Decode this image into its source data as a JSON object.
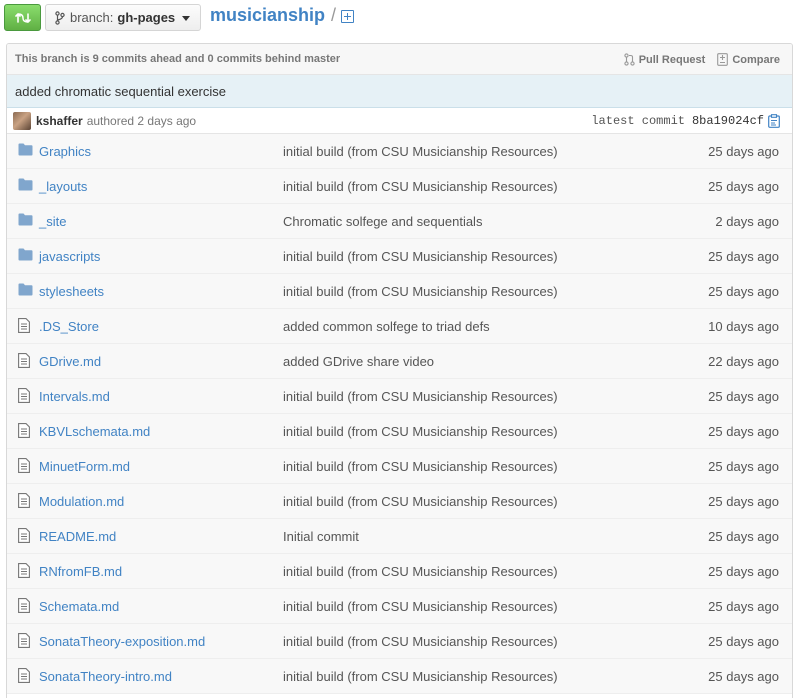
{
  "header": {
    "branch_prefix": "branch:",
    "branch_name": "gh-pages",
    "repo_name": "musicianship",
    "path_separator": "/"
  },
  "branch_status": {
    "text": "This branch is 9 commits ahead and 0 commits behind master",
    "pull_request_label": "Pull Request",
    "compare_label": "Compare"
  },
  "latest_commit": {
    "message": "added chromatic sequential exercise",
    "author": "kshaffer",
    "authored_text": "authored 2 days ago",
    "label": "latest commit",
    "sha": "8ba19024cf"
  },
  "files": [
    {
      "name": "Graphics",
      "type": "folder",
      "message": "initial build (from CSU Musicianship Resources)",
      "age": "25 days ago"
    },
    {
      "name": "_layouts",
      "type": "folder",
      "message": "initial build (from CSU Musicianship Resources)",
      "age": "25 days ago"
    },
    {
      "name": "_site",
      "type": "folder",
      "message": "Chromatic solfege and sequentials",
      "age": "2 days ago"
    },
    {
      "name": "javascripts",
      "type": "folder",
      "message": "initial build (from CSU Musicianship Resources)",
      "age": "25 days ago"
    },
    {
      "name": "stylesheets",
      "type": "folder",
      "message": "initial build (from CSU Musicianship Resources)",
      "age": "25 days ago"
    },
    {
      "name": ".DS_Store",
      "type": "file",
      "message": "added common solfege to triad defs",
      "age": "10 days ago"
    },
    {
      "name": "GDrive.md",
      "type": "file",
      "message": "added GDrive share video",
      "age": "22 days ago"
    },
    {
      "name": "Intervals.md",
      "type": "file",
      "message": "initial build (from CSU Musicianship Resources)",
      "age": "25 days ago"
    },
    {
      "name": "KBVLschemata.md",
      "type": "file",
      "message": "initial build (from CSU Musicianship Resources)",
      "age": "25 days ago"
    },
    {
      "name": "MinuetForm.md",
      "type": "file",
      "message": "initial build (from CSU Musicianship Resources)",
      "age": "25 days ago"
    },
    {
      "name": "Modulation.md",
      "type": "file",
      "message": "initial build (from CSU Musicianship Resources)",
      "age": "25 days ago"
    },
    {
      "name": "README.md",
      "type": "file",
      "message": "Initial commit",
      "age": "25 days ago"
    },
    {
      "name": "RNfromFB.md",
      "type": "file",
      "message": "initial build (from CSU Musicianship Resources)",
      "age": "25 days ago"
    },
    {
      "name": "Schemata.md",
      "type": "file",
      "message": "initial build (from CSU Musicianship Resources)",
      "age": "25 days ago"
    },
    {
      "name": "SonataTheory-exposition.md",
      "type": "file",
      "message": "initial build (from CSU Musicianship Resources)",
      "age": "25 days ago"
    },
    {
      "name": "SonataTheory-intro.md",
      "type": "file",
      "message": "initial build (from CSU Musicianship Resources)",
      "age": "25 days ago"
    }
  ],
  "colors": {
    "link": "#4183c4",
    "folder": "#80a6cd",
    "commit_bar": "#e6f1f6",
    "compare_green": "#60b044"
  }
}
